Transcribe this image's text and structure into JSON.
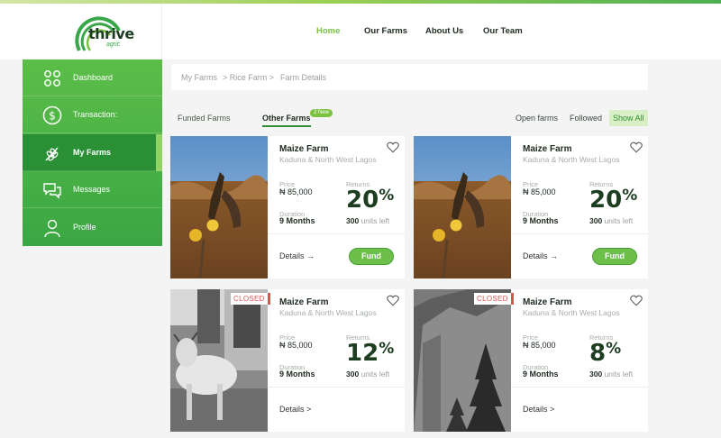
{
  "brand": {
    "name": "thrive",
    "sub": "agric"
  },
  "nav": {
    "home": "Home",
    "our_farms": "Our Farms",
    "about_us": "About Us",
    "our_team": "Our Team"
  },
  "sidebar": {
    "items": [
      {
        "label": "Dashboard",
        "icon": "dashboard-icon"
      },
      {
        "label": "Transaction:",
        "icon": "dollar-icon"
      },
      {
        "label": "My Farms",
        "icon": "wheat-icon"
      },
      {
        "label": "Messages",
        "icon": "chat-icon"
      },
      {
        "label": "Profile",
        "icon": "user-icon"
      }
    ]
  },
  "breadcrumb": [
    "My Farms",
    "> Rice Farm >",
    "Farm Details"
  ],
  "tabs": {
    "funded": "Funded Farms",
    "other": "Other Farms",
    "new_badge": "2 New"
  },
  "filters": {
    "open": "Open farms",
    "followed": "Followed",
    "show_all": "Show All"
  },
  "labels": {
    "price": "Price",
    "returns": "Returns",
    "duration": "Duration",
    "units_left": "units left",
    "details_arrow": "Details →",
    "details_gt": "Details >",
    "fund": "Fund",
    "closed": "CLOSED"
  },
  "cards": [
    {
      "title": "Maize Farm",
      "location": "Kaduna & North West Lagos",
      "price": "₦ 85,000",
      "returns": "20",
      "duration": "9 Months",
      "units": "300",
      "status": "open"
    },
    {
      "title": "Maize Farm",
      "location": "Kaduna & North West Lagos",
      "price": "₦ 85,000",
      "returns": "20",
      "duration": "9 Months",
      "units": "300",
      "status": "open"
    },
    {
      "title": "Maize Farm",
      "location": "Kaduna & North West Lagos",
      "price": "₦ 85,000",
      "returns": "12",
      "duration": "9 Months",
      "units": "300",
      "status": "closed"
    },
    {
      "title": "Maize Farm",
      "location": "Kaduna & North West Lagos",
      "price": "₦ 85,000",
      "returns": "8",
      "duration": "9 Months",
      "units": "300",
      "status": "closed"
    }
  ],
  "colors": {
    "accent": "#7cc242",
    "dark_green": "#1d3d21",
    "closed_red": "#d9534f"
  }
}
